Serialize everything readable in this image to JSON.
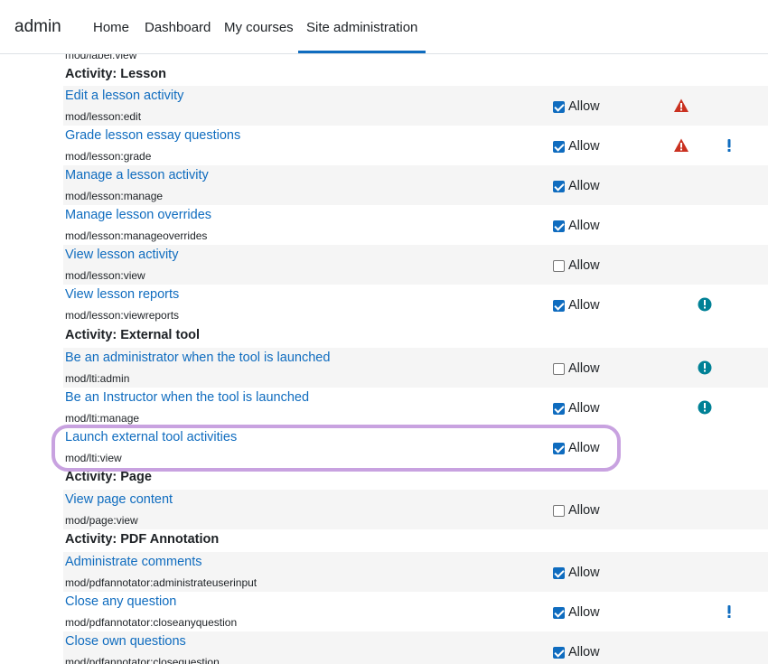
{
  "nav": {
    "brand": "admin",
    "items": [
      {
        "label": "Home"
      },
      {
        "label": "Dashboard"
      },
      {
        "label": "My courses"
      },
      {
        "label": "Site administration"
      }
    ]
  },
  "cut_off_code": "mod/label:view",
  "groups": [
    {
      "title": "Activity: Lesson"
    },
    {
      "title": "Activity: External tool"
    },
    {
      "title": "Activity: Page"
    },
    {
      "title": "Activity: PDF Annotation"
    }
  ],
  "allow_label": "Allow",
  "capabilities": [
    {
      "name": "Edit a lesson activity",
      "code": "mod/lesson:edit",
      "allowed": true,
      "risks": [
        "xss-risk-triangle"
      ]
    },
    {
      "name": "Grade lesson essay questions",
      "code": "mod/lesson:grade",
      "allowed": true,
      "risks": [
        "xss-risk-triangle",
        "privacy-risk-exclamation"
      ]
    },
    {
      "name": "Manage a lesson activity",
      "code": "mod/lesson:manage",
      "allowed": true,
      "risks": []
    },
    {
      "name": "Manage lesson overrides",
      "code": "mod/lesson:manageoverrides",
      "allowed": true,
      "risks": []
    },
    {
      "name": "View lesson activity",
      "code": "mod/lesson:view",
      "allowed": false,
      "risks": []
    },
    {
      "name": "View lesson reports",
      "code": "mod/lesson:viewreports",
      "allowed": true,
      "risks": [
        "personal-risk-circle"
      ]
    },
    {
      "name": "Be an administrator when the tool is launched",
      "code": "mod/lti:admin",
      "allowed": false,
      "risks": [
        "personal-risk-circle"
      ]
    },
    {
      "name": "Be an Instructor when the tool is launched",
      "code": "mod/lti:manage",
      "allowed": true,
      "risks": [
        "personal-risk-circle"
      ]
    },
    {
      "name": "Launch external tool activities",
      "code": "mod/lti:view",
      "allowed": true,
      "risks": []
    },
    {
      "name": "View page content",
      "code": "mod/page:view",
      "allowed": false,
      "risks": []
    },
    {
      "name": "Administrate comments",
      "code": "mod/pdfannotator:administrateuserinput",
      "allowed": true,
      "risks": []
    },
    {
      "name": "Close any question",
      "code": "mod/pdfannotator:closeanyquestion",
      "allowed": true,
      "risks": [
        "privacy-risk-exclamation"
      ]
    },
    {
      "name": "Close own questions",
      "code": "mod/pdfannotator:closequestion",
      "allowed": true,
      "risks": []
    }
  ],
  "colors": {
    "link": "#0f6cbf",
    "xss_risk": "#ca3120",
    "personal_risk": "#008196",
    "highlight": "#c8a2e0"
  }
}
